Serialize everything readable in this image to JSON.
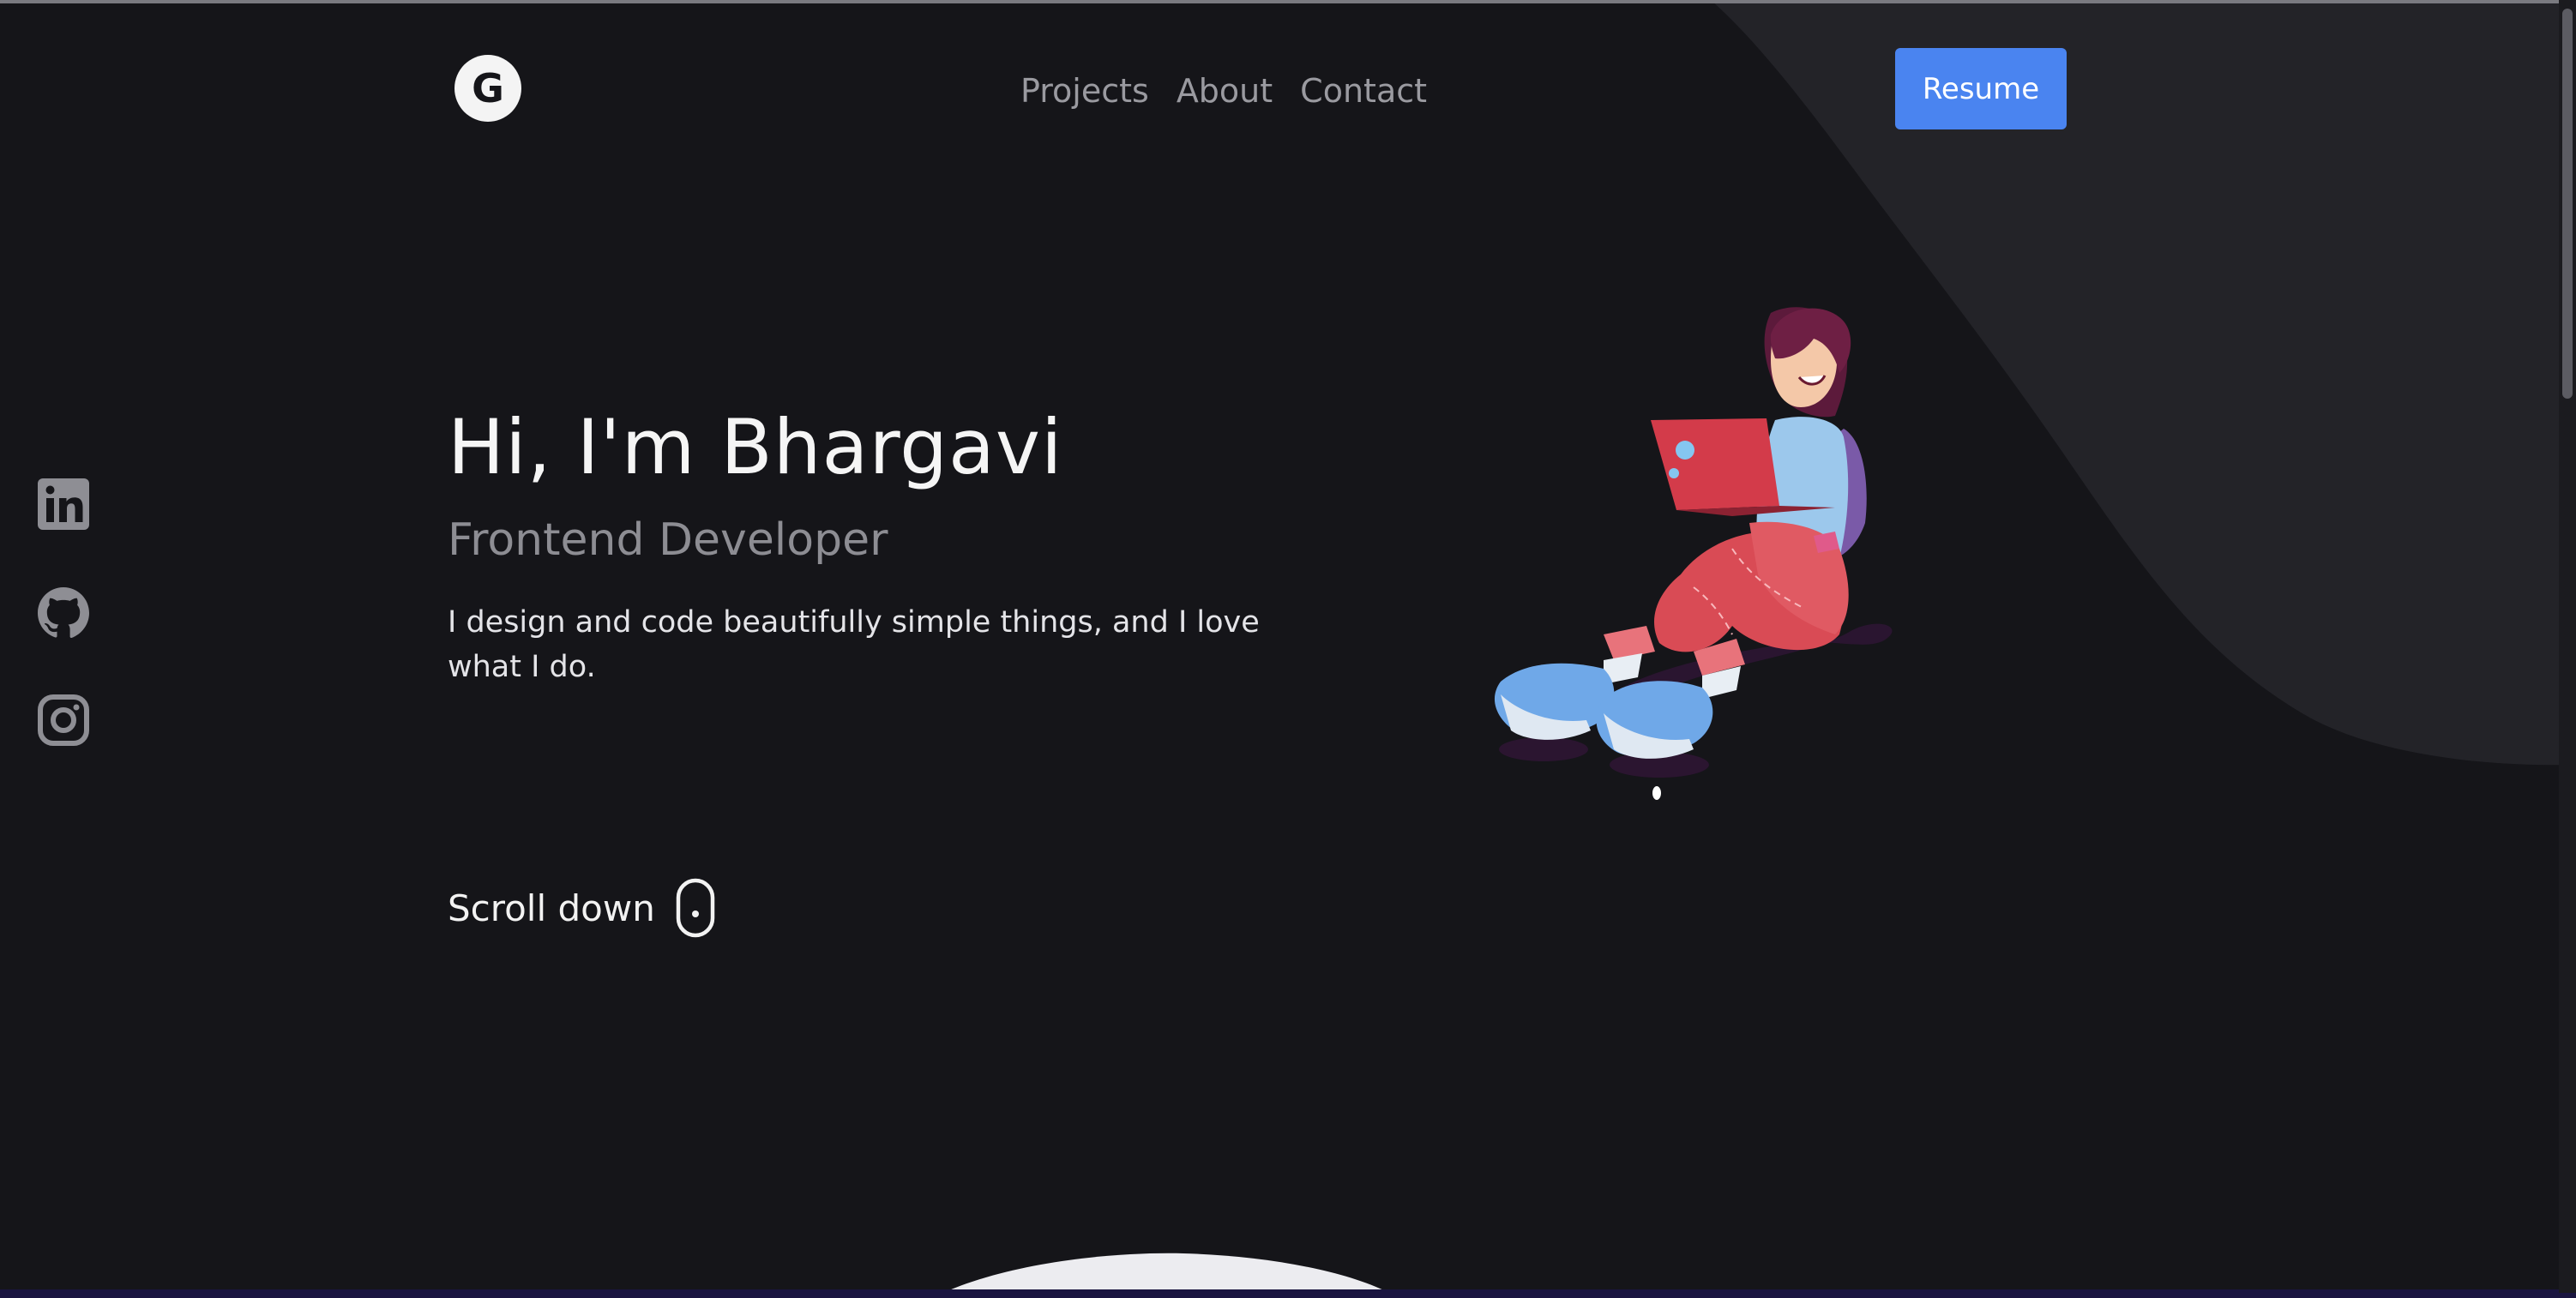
{
  "header": {
    "logo_letter": "G",
    "nav": [
      {
        "label": "Projects"
      },
      {
        "label": "About"
      },
      {
        "label": "Contact"
      }
    ],
    "resume_label": "Resume"
  },
  "social": [
    {
      "icon": "linkedin-icon"
    },
    {
      "icon": "github-icon"
    },
    {
      "icon": "instagram-icon"
    }
  ],
  "hero": {
    "title": "Hi, I'm Bhargavi",
    "subtitle": "Frontend Developer",
    "description": "I design and code beautifully simple things, and I love what I do."
  },
  "scroll": {
    "label": "Scroll down",
    "icon": "mouse-icon"
  },
  "illustration": {
    "icon": "developer-girl-illustration"
  },
  "colors": {
    "background": "#151519",
    "wave": "#232328",
    "accent": "#4a84f0",
    "muted_text": "#9a9aa0"
  }
}
